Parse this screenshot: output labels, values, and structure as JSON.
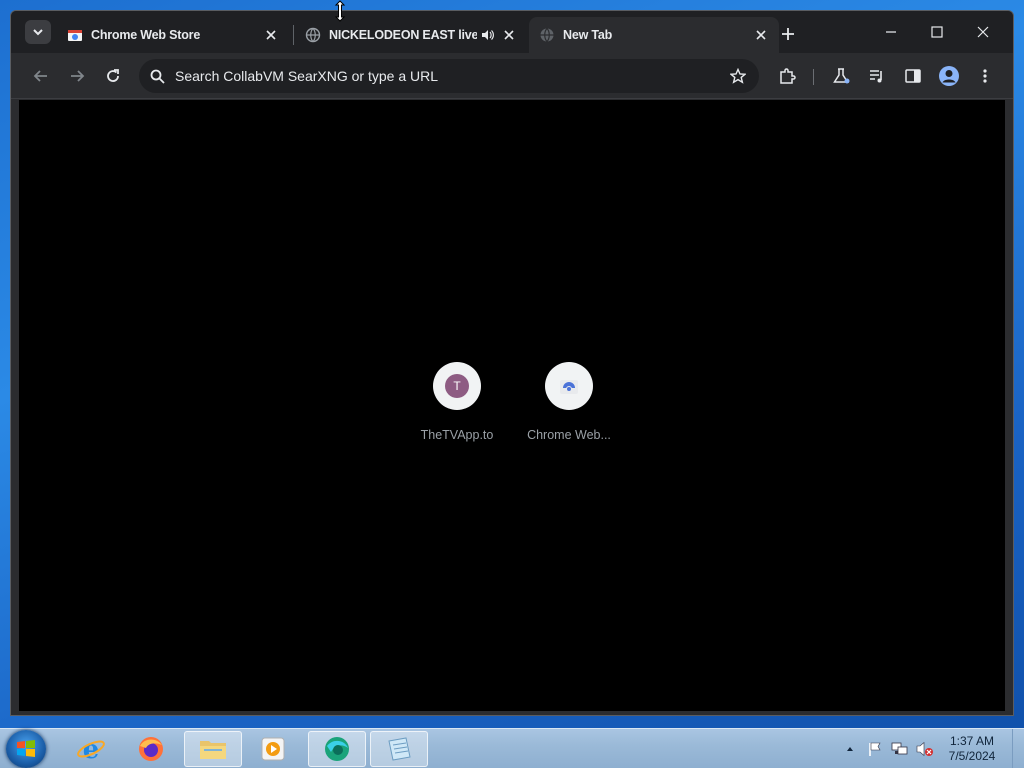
{
  "browser": {
    "tabs": [
      {
        "title": "Chrome Web Store",
        "favicon": "chrome-web-store-icon",
        "active": false
      },
      {
        "title": "NICKELODEON EAST live st",
        "favicon": "globe-icon",
        "audio": true,
        "active": false
      },
      {
        "title": "New Tab",
        "favicon": "globe-icon",
        "active": true
      }
    ],
    "omnibox": {
      "placeholder": "Search CollabVM SearXNG or type a URL",
      "value": ""
    },
    "shortcuts": [
      {
        "label": "TheTVApp.to",
        "letter": "T",
        "icon": "letter-t-icon"
      },
      {
        "label": "Chrome Web...",
        "icon": "chrome-web-store-icon"
      }
    ]
  },
  "taskbar": {
    "apps": [
      "internet-explorer-icon",
      "firefox-icon",
      "file-explorer-icon",
      "media-player-icon",
      "browser-app-icon",
      "notepad-icon"
    ],
    "clock": {
      "time": "1:37 AM",
      "date": "7/5/2024"
    }
  },
  "colors": {
    "accent": "#8ab4f8",
    "tab_bg": "#1f2023",
    "toolbar": "#2b2c2f",
    "content": "#000000"
  }
}
